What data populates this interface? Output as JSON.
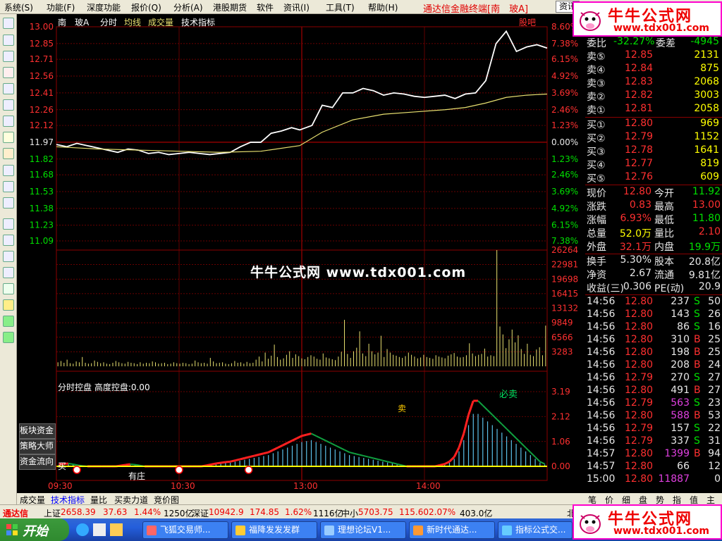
{
  "menu": [
    {
      "label": "系统(S)",
      "color": "#000"
    },
    {
      "label": "功能(F)",
      "color": "#000"
    },
    {
      "label": "深度功能",
      "color": "#000"
    },
    {
      "label": "报价(Q)",
      "color": "#000"
    },
    {
      "label": "分析(A)",
      "color": "#000"
    },
    {
      "label": "港股期货",
      "color": "#000"
    },
    {
      "label": "软件",
      "color": "#000"
    },
    {
      "label": "资讯(I)",
      "color": "#000"
    },
    {
      "label": "工具(T)",
      "color": "#000"
    },
    {
      "label": "帮助(H)",
      "color": "#000"
    }
  ],
  "brand_title": "通达信金融终端[南　玻A]",
  "menu_button": "资讯",
  "watermark": {
    "line1": "牛牛公式网",
    "line2": "www.tdx001.com"
  },
  "center_watermark": "牛牛公式网 www.tdx001.com",
  "chart_header": {
    "name": "南　玻A",
    "items": [
      "分时",
      "均线",
      "成交量",
      "技术指标"
    ],
    "right": "股吧"
  },
  "chart_data": [
    {
      "type": "line",
      "y_ticks_left": [
        "13.00",
        "12.85",
        "12.71",
        "12.56",
        "12.41",
        "12.26",
        "12.12",
        "11.97",
        "11.82",
        "11.68",
        "11.53",
        "11.38",
        "11.23",
        "11.09"
      ],
      "y_ticks_right": [
        "8.60%",
        "7.38%",
        "6.15%",
        "4.92%",
        "3.69%",
        "2.46%",
        "1.23%",
        "0.00%",
        "1.23%",
        "2.46%",
        "3.69%",
        "4.92%",
        "6.15%",
        "7.38%"
      ],
      "prev_close": 11.97,
      "ylim": [
        11.09,
        13.0
      ],
      "x_ticks": [
        "09:30",
        "10:30",
        "13:00",
        "14:00"
      ],
      "series": [
        {
          "name": "分时",
          "color": "#ffffff",
          "x": [
            0,
            5,
            10,
            15,
            20,
            25,
            30,
            35,
            40,
            45,
            50,
            55,
            60,
            65,
            70,
            75,
            80,
            85,
            90,
            95,
            100,
            105,
            110,
            115,
            119,
            125,
            130,
            135,
            140,
            145,
            150,
            155,
            160,
            165,
            170,
            175,
            180,
            185,
            190,
            195,
            200,
            205,
            210,
            215,
            220,
            225,
            230,
            235,
            240
          ],
          "values": [
            11.95,
            11.93,
            11.96,
            11.94,
            11.92,
            11.9,
            11.88,
            11.91,
            11.9,
            11.87,
            11.88,
            11.86,
            11.87,
            11.88,
            11.87,
            11.86,
            11.87,
            11.88,
            11.93,
            11.97,
            11.97,
            12.05,
            12.07,
            12.1,
            12.08,
            12.12,
            12.3,
            12.28,
            12.41,
            12.41,
            12.45,
            12.43,
            12.39,
            12.41,
            12.4,
            12.38,
            12.37,
            12.38,
            12.39,
            12.36,
            12.4,
            12.41,
            12.52,
            12.85,
            12.96,
            12.78,
            12.82,
            12.84,
            12.81
          ]
        },
        {
          "name": "均线",
          "color": "#e8e070",
          "x": [
            0,
            20,
            40,
            60,
            80,
            100,
            119,
            130,
            145,
            160,
            175,
            190,
            200,
            210,
            220,
            230,
            240
          ],
          "values": [
            11.93,
            11.91,
            11.9,
            11.89,
            11.88,
            11.89,
            11.94,
            12.06,
            12.17,
            12.22,
            12.24,
            12.26,
            12.28,
            12.32,
            12.37,
            12.39,
            12.4
          ]
        }
      ]
    },
    {
      "type": "bar",
      "name": "成交量",
      "y_ticks": [
        "26264",
        "22981",
        "19698",
        "16415",
        "13132",
        "9849",
        "6566",
        "3283"
      ],
      "ylim": [
        0,
        26264
      ],
      "values": [
        900,
        1200,
        800,
        1500,
        700,
        600,
        1100,
        900,
        2100,
        800,
        600,
        700,
        1300,
        1000,
        700,
        900,
        600,
        500,
        800,
        1200,
        900,
        700,
        600,
        1000,
        800,
        700,
        500,
        900,
        600,
        800,
        700,
        1100,
        900,
        600,
        700,
        800,
        500,
        600,
        900,
        700,
        600,
        800,
        700,
        500,
        600,
        1300,
        900,
        700,
        800,
        600,
        1900,
        1100,
        700,
        800,
        900,
        600,
        500,
        700,
        1200,
        800,
        900,
        600,
        1000,
        700,
        800,
        1500,
        2200,
        1100,
        3100,
        1700,
        2400,
        4900,
        2100,
        1500,
        1800,
        2600,
        3400,
        1900,
        2700,
        2300,
        1800,
        1600,
        2100,
        2500,
        2200,
        1700,
        1500,
        2900,
        2000,
        1800,
        1600,
        1400,
        2200,
        3300,
        10500,
        2800,
        1900,
        3400,
        4200,
        7900,
        2900,
        2300,
        5100,
        3400,
        2700,
        3100,
        6900,
        2100,
        3900,
        3100,
        2600,
        2400,
        2100,
        1900,
        2300,
        3100,
        2600,
        2200,
        1800,
        2000,
        2600,
        2100,
        1900,
        1700,
        2500,
        2200,
        2000,
        1800,
        2400,
        2700,
        3000,
        2200,
        2000,
        2100,
        2500,
        5200,
        2900,
        2300,
        2600,
        2800,
        4000,
        2200,
        2500,
        2300,
        26264,
        9000,
        7200,
        4100,
        6100,
        8300,
        5400,
        7000,
        3900,
        2800,
        5100,
        2600,
        2300,
        3800,
        4300,
        2500,
        9200
      ]
    },
    {
      "type": "bar",
      "name": "分时控盘",
      "subtitle": "高度控盘:0.00",
      "y_ticks": [
        "3.19",
        "2.12",
        "1.06",
        "0.00"
      ],
      "ylim": [
        0,
        3.19
      ],
      "values": [
        0.08,
        0.1,
        0.12,
        0.09,
        0.05,
        0.02,
        0.0,
        0.0,
        0.0,
        0.0,
        0.0,
        0.0,
        0.0,
        0.03,
        0.06,
        0.09,
        0.07,
        0.04,
        0.0,
        0.0,
        0.0,
        0.0,
        0.0,
        0.0,
        0.0,
        0.0,
        0.0,
        0.0,
        0.0,
        0.0,
        0.0,
        0.04,
        0.08,
        0.12,
        0.15,
        0.18,
        0.2,
        0.25,
        0.3,
        0.35,
        0.4,
        0.45,
        0.5,
        0.55,
        0.6,
        0.7,
        0.8,
        0.9,
        1.0,
        1.1,
        1.2,
        1.3,
        1.35,
        1.4,
        1.3,
        1.2,
        1.1,
        1.0,
        0.9,
        0.8,
        0.7,
        0.6,
        0.55,
        0.5,
        0.45,
        0.4,
        0.35,
        0.3,
        0.25,
        0.2,
        0.15,
        0.1,
        0.05,
        0.0,
        0.0,
        0.0,
        0.0,
        0.0,
        0.0,
        0.0,
        0.05,
        0.1,
        0.2,
        0.4,
        0.8,
        1.4,
        2.2,
        2.8,
        2.8,
        2.6,
        2.4,
        2.2,
        2.0,
        1.8,
        1.6,
        1.4,
        1.2,
        1.0,
        0.8,
        0.6,
        0.4,
        0.2,
        0.1
      ],
      "labels": {
        "buy": "买",
        "sell": "卖",
        "top_sell": "必卖",
        "bottom": "有庄"
      }
    }
  ],
  "side_buttons": [
    "板块资金",
    "策略大师",
    "资金流向"
  ],
  "quote": {
    "weibi": {
      "label": "委比",
      "value": "-32.27%",
      "label2": "委差",
      "value2": "-4945"
    },
    "asks": [
      {
        "label": "卖⑤",
        "price": "12.85",
        "vol": "2131"
      },
      {
        "label": "卖④",
        "price": "12.84",
        "vol": "875"
      },
      {
        "label": "卖③",
        "price": "12.83",
        "vol": "2068"
      },
      {
        "label": "卖②",
        "price": "12.82",
        "vol": "3003"
      },
      {
        "label": "卖①",
        "price": "12.81",
        "vol": "2058"
      }
    ],
    "bids": [
      {
        "label": "买①",
        "price": "12.80",
        "vol": "969"
      },
      {
        "label": "买②",
        "price": "12.79",
        "vol": "1152"
      },
      {
        "label": "买③",
        "price": "12.78",
        "vol": "1641"
      },
      {
        "label": "买④",
        "price": "12.77",
        "vol": "819"
      },
      {
        "label": "买⑤",
        "price": "12.76",
        "vol": "609"
      }
    ],
    "stats": [
      {
        "l1": "现价",
        "v1": "12.80",
        "c1": "#ff3030",
        "l2": "今开",
        "v2": "11.92",
        "c2": "#00e000"
      },
      {
        "l1": "涨跌",
        "v1": "0.83",
        "c1": "#ff3030",
        "l2": "最高",
        "v2": "13.00",
        "c2": "#ff3030"
      },
      {
        "l1": "涨幅",
        "v1": "6.93%",
        "c1": "#ff3030",
        "l2": "最低",
        "v2": "11.80",
        "c2": "#00e000"
      },
      {
        "l1": "总量",
        "v1": "52.0万",
        "c1": "#ffff00",
        "l2": "量比",
        "v2": "2.10",
        "c2": "#ff3030"
      },
      {
        "l1": "外盘",
        "v1": "32.1万",
        "c1": "#ff3030",
        "l2": "内盘",
        "v2": "19.9万",
        "c2": "#00e000"
      }
    ],
    "stats2": [
      {
        "l1": "换手",
        "v1": "5.30%",
        "l2": "股本",
        "v2": "20.8亿"
      },
      {
        "l1": "净资",
        "v1": "2.67",
        "l2": "流通",
        "v2": "9.81亿"
      },
      {
        "l1": "收益(三)",
        "v1": "0.306",
        "l2": "PE(动)",
        "v2": "20.9"
      }
    ],
    "ticks": [
      {
        "t": "14:56",
        "p": "12.80",
        "v": "237",
        "s": "S",
        "n": "50",
        "vc": "#e8e8e8"
      },
      {
        "t": "14:56",
        "p": "12.80",
        "v": "143",
        "s": "S",
        "n": "26",
        "vc": "#e8e8e8"
      },
      {
        "t": "14:56",
        "p": "12.80",
        "v": "86",
        "s": "S",
        "n": "16",
        "vc": "#e8e8e8"
      },
      {
        "t": "14:56",
        "p": "12.80",
        "v": "310",
        "s": "B",
        "n": "25",
        "vc": "#e8e8e8"
      },
      {
        "t": "14:56",
        "p": "12.80",
        "v": "198",
        "s": "B",
        "n": "25",
        "vc": "#e8e8e8"
      },
      {
        "t": "14:56",
        "p": "12.80",
        "v": "208",
        "s": "B",
        "n": "24",
        "vc": "#e8e8e8"
      },
      {
        "t": "14:56",
        "p": "12.79",
        "v": "270",
        "s": "S",
        "n": "27",
        "vc": "#e8e8e8"
      },
      {
        "t": "14:56",
        "p": "12.80",
        "v": "491",
        "s": "B",
        "n": "27",
        "vc": "#e8e8e8"
      },
      {
        "t": "14:56",
        "p": "12.79",
        "v": "563",
        "s": "S",
        "n": "23",
        "vc": "#e040e0"
      },
      {
        "t": "14:56",
        "p": "12.80",
        "v": "588",
        "s": "B",
        "n": "53",
        "vc": "#e040e0"
      },
      {
        "t": "14:56",
        "p": "12.79",
        "v": "157",
        "s": "S",
        "n": "22",
        "vc": "#e8e8e8"
      },
      {
        "t": "14:56",
        "p": "12.79",
        "v": "337",
        "s": "S",
        "n": "31",
        "vc": "#e8e8e8"
      },
      {
        "t": "14:57",
        "p": "12.80",
        "v": "1399",
        "s": "B",
        "n": "94",
        "vc": "#e040e0"
      },
      {
        "t": "14:57",
        "p": "12.80",
        "v": "66",
        "s": "",
        "n": "12",
        "vc": "#e8e8e8"
      },
      {
        "t": "15:00",
        "p": "12.80",
        "v": "11887",
        "s": "",
        "n": "0",
        "vc": "#e040e0"
      }
    ]
  },
  "bottom_tabs": [
    "成交量",
    "技术指标",
    "量比",
    "买卖力道",
    "竞价图"
  ],
  "quote_tabs": [
    "笔",
    "价",
    "细",
    "盘",
    "势",
    "指",
    "值",
    "主"
  ],
  "statusbar": {
    "logo": "通达信",
    "items": [
      {
        "label": "上证",
        "value": "2658.39",
        "chg": "37.63",
        "pct": "1.44%",
        "amt": "1250亿"
      },
      {
        "label": "深证",
        "value": "10942.9",
        "chg": "174.85",
        "pct": "1.62%",
        "amt": "1116亿"
      },
      {
        "label": "中小",
        "value": "5703.75",
        "chg": "115.60",
        "pct": "2.07%",
        "amt": "403.0亿"
      }
    ],
    "tail": "北"
  },
  "taskbar": {
    "start": "开始",
    "tasks": [
      "飞狐交易师...",
      "福降发发发群",
      "理想论坛V1...",
      "新时代通达...",
      "指标公式交..."
    ]
  },
  "colors": {
    "up": "#ff3030",
    "down": "#00e000",
    "grid": "#8b0000",
    "bg": "#000000"
  }
}
